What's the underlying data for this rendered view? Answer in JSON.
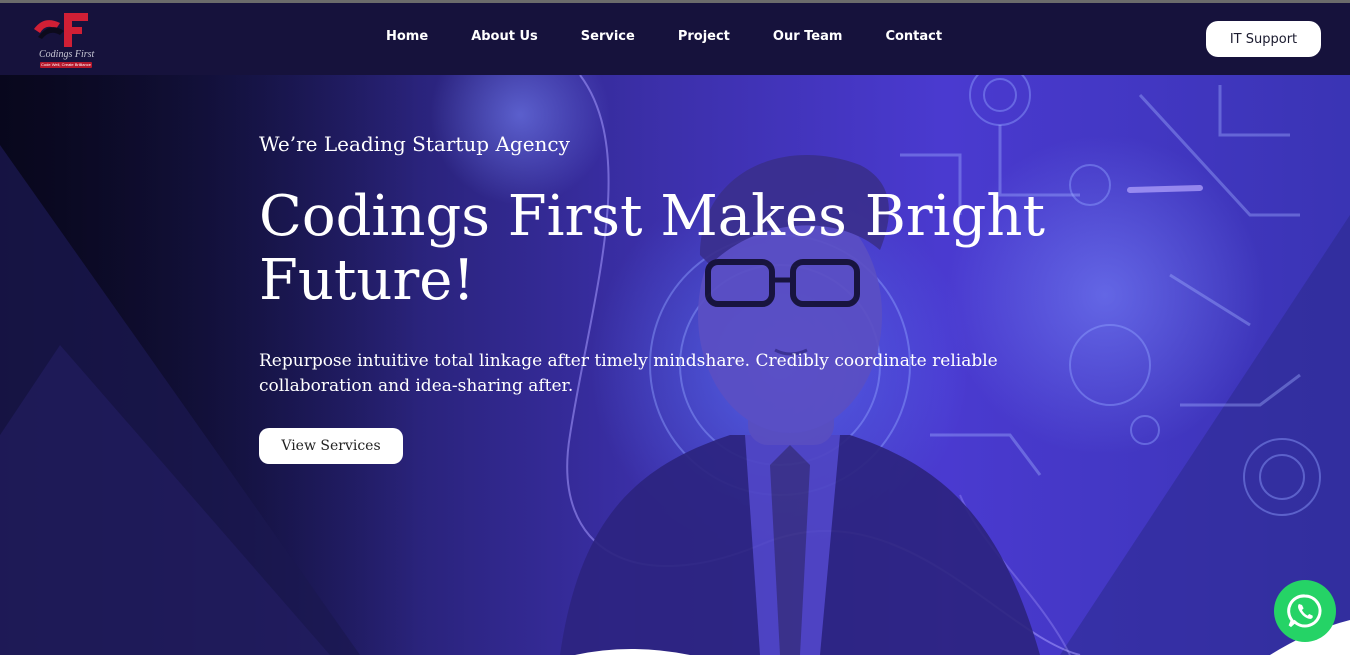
{
  "brand": {
    "logo_letter": "F",
    "logo_text": "Codings First",
    "logo_tagline": "Code Well, Create Brilliance"
  },
  "nav": {
    "items": [
      "Home",
      "About Us",
      "Service",
      "Project",
      "Our Team",
      "Contact"
    ],
    "support_label": "IT Support"
  },
  "hero": {
    "kicker": "We’re Leading Startup Agency",
    "headline": "Codings First Makes Bright Future!",
    "description": "Repurpose intuitive total linkage after timely mindshare. Credibly coordinate reliable collaboration and idea-sharing after.",
    "cta_label": "View Services"
  },
  "colors": {
    "nav_background": "#16123c",
    "hero_tint": "#4a3ad0",
    "logo_red": "#d01f35",
    "whatsapp_green": "#25d366"
  },
  "icons": {
    "whatsapp": "whatsapp-icon"
  }
}
